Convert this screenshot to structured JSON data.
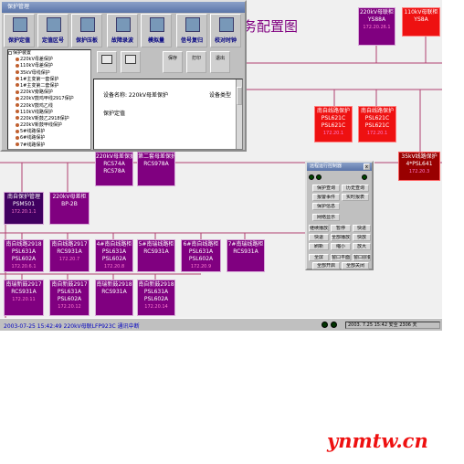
{
  "diagram": {
    "title": "务配置图"
  },
  "main_window": {
    "title": "保护管理",
    "toolbar": [
      {
        "label": "保护定值",
        "icon": "document-icon"
      },
      {
        "label": "定值区号",
        "icon": "zone-icon"
      },
      {
        "label": "保护压板",
        "icon": "plate-icon"
      },
      {
        "label": "故障录波",
        "icon": "waveform-icon"
      },
      {
        "label": "模拟量",
        "icon": "meter-icon"
      },
      {
        "label": "信号复归",
        "icon": "reset-icon"
      },
      {
        "label": "校对时钟",
        "icon": "clock-icon"
      }
    ],
    "tree": [
      "保护装置",
      "220kV母差保护",
      "110kV母差保护",
      "35kV母线保护",
      "1#主变第一套保护",
      "1#主变第二套保护",
      "220kV旁路保护",
      "220kV鼓鸡甲线2917保护",
      "220kV鼓鸡乙线",
      "110kV线路保护",
      "220kV新鼓乙2918保护",
      "220kV新鼓甲线保护",
      "5#线路保护",
      "6#线路保护",
      "7#线路保护"
    ],
    "sub_toolbar": [
      {
        "label": "",
        "icon": "folder-icon"
      },
      {
        "label": "",
        "icon": "monitor-icon"
      },
      {
        "label": "保存",
        "icon": "save-icon"
      },
      {
        "label": "打印",
        "icon": "print-icon"
      },
      {
        "label": "退出",
        "icon": "exit-icon"
      }
    ],
    "info": {
      "device_name": "设备名称: 220kV母差保护",
      "device_type": "设备类型",
      "setting": "保护定值"
    }
  },
  "nodes": [
    {
      "lines": [
        "220kV母联柜",
        "YS88A"
      ],
      "sub": "172.20.26.1"
    },
    {
      "lines": [
        "110kV母联柜",
        "YS8A"
      ],
      "sub": ""
    },
    {
      "lines": [
        "南自线路保护",
        "PSL621C",
        "PSL621C"
      ],
      "sub": "172.20.1"
    },
    {
      "lines": [
        "南自线路保护",
        "PSL621C",
        "PSL621C"
      ],
      "sub": "172.20.1"
    },
    {
      "lines": [
        "35kV线路保护",
        "4*PSL641"
      ],
      "sub": "172.20.3"
    },
    {
      "lines": [
        "220kV母差保护",
        "RCS74A",
        "RCS78A"
      ],
      "sub": ""
    },
    {
      "lines": [
        "第二套母差保护",
        "RCS978A"
      ],
      "sub": ""
    },
    {
      "lines": [
        "南自保护管理",
        "PSM501"
      ],
      "sub": "172.20.1.1"
    },
    {
      "lines": [
        "220kV母差柜",
        "BP-2B"
      ],
      "sub": ""
    },
    {
      "lines": [
        "南自线路2918",
        "PSL631A",
        "PSL602A"
      ],
      "sub": "172.20.6.1"
    },
    {
      "lines": [
        "南自线路2917",
        "RCS931A"
      ],
      "sub": "172.20.7"
    },
    {
      "lines": [
        "4#南自线路柜",
        "PSL631A",
        "PSL602A"
      ],
      "sub": "172.20.8"
    },
    {
      "lines": [
        "5#南瑞线路柜",
        "RCS931A"
      ],
      "sub": ""
    },
    {
      "lines": [
        "6#南自线路柜",
        "PSL631A",
        "PSL602A"
      ],
      "sub": "172.20.9"
    },
    {
      "lines": [
        "7#南瑞线路柜",
        "RCS931A"
      ],
      "sub": ""
    },
    {
      "lines": [
        "南瑞新鼓2917",
        "RCS931A"
      ],
      "sub": "172.20.11"
    },
    {
      "lines": [
        "南自新鼓2917",
        "PSL631A",
        "PSL602A"
      ],
      "sub": "172.20.12"
    },
    {
      "lines": [
        "南瑞新鼓2918",
        "RCS931A"
      ],
      "sub": ""
    },
    {
      "lines": [
        "南自新鼓2918",
        "PSL631A",
        "PSL602A"
      ],
      "sub": "172.20.14"
    }
  ],
  "control_panel": {
    "title": "远程运行控制器",
    "close": "x",
    "buttons": [
      "保护查询",
      "历史查询",
      "报警事件",
      "实时报表",
      "保护信息",
      "网络显示",
      "继续播放",
      "暂停",
      "快进",
      "快退",
      "全部播放",
      "快放",
      "刷新",
      "缩小",
      "放大",
      "全屏",
      "窗口平面",
      "窗口层叠",
      "全部开启",
      "全部关闭"
    ]
  },
  "status_bar": {
    "message": "2003-07-25 15:42:49 220kV母联LFP923C 通讯中断",
    "time": "2003. 7.25   15:42   安全 2306 天"
  },
  "watermark": "ynmtw.cn"
}
